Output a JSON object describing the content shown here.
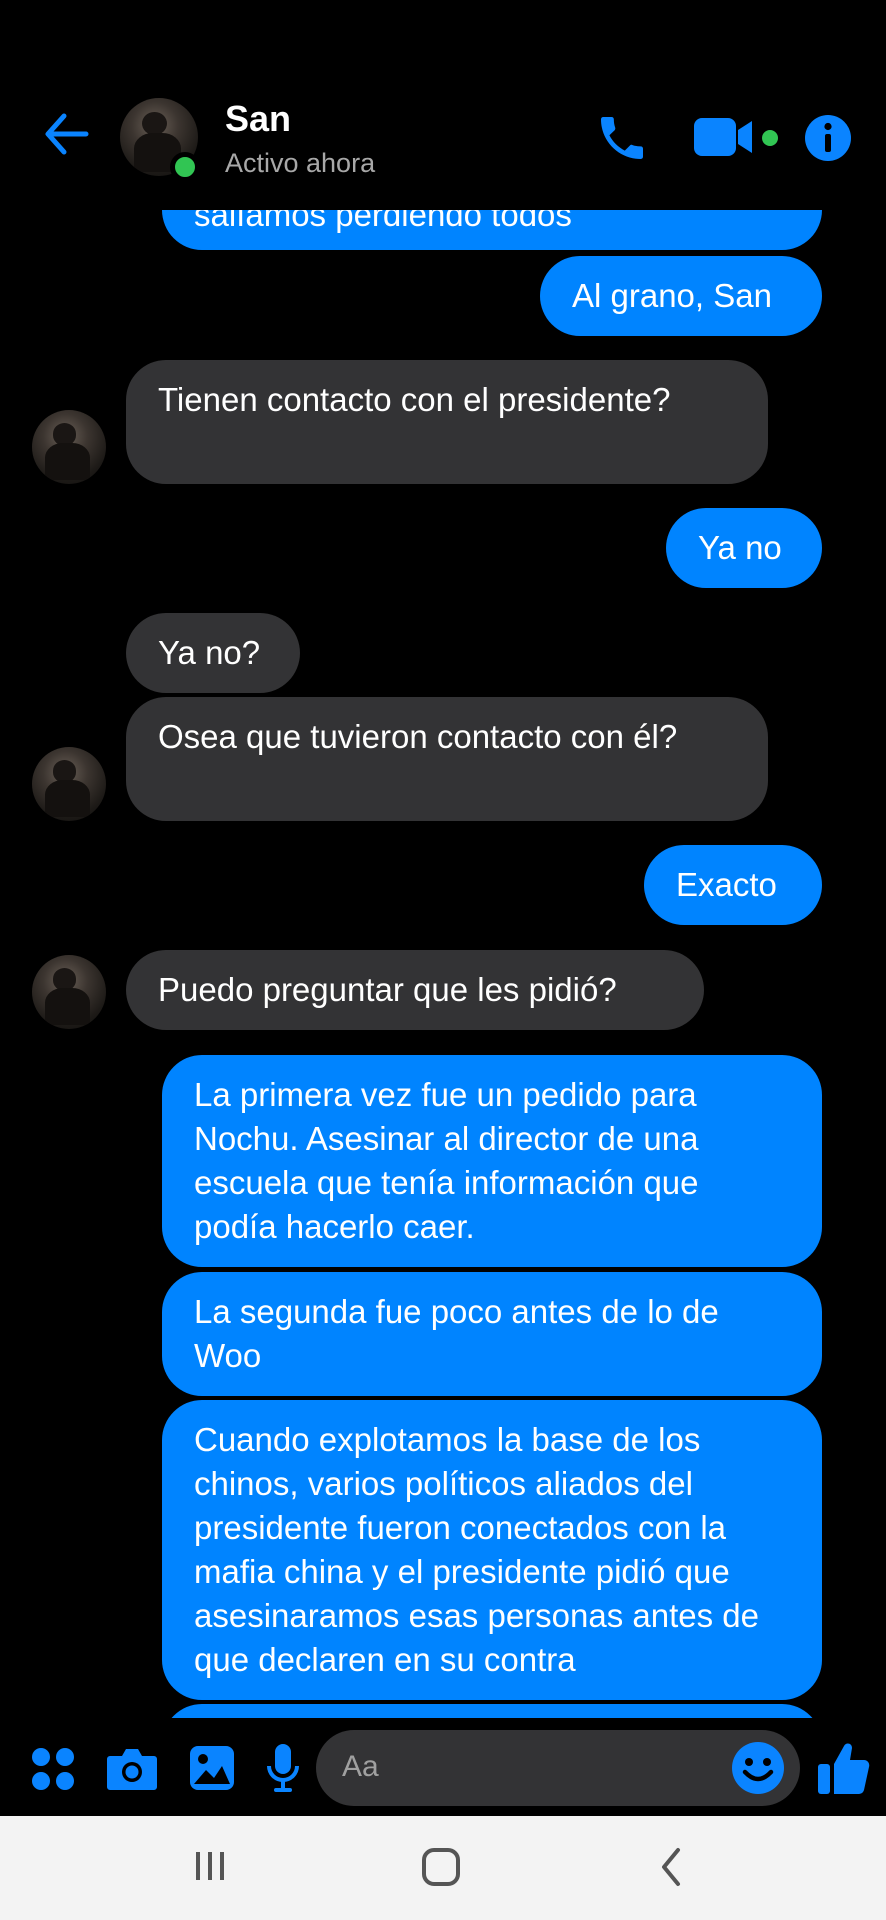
{
  "header": {
    "name": "San",
    "status": "Activo ahora"
  },
  "messages": [
    {
      "dir": "out",
      "text": "salíamos perdiendo todos"
    },
    {
      "dir": "out",
      "text": "Al grano, San"
    },
    {
      "dir": "in",
      "text": "Tienen contacto con el presidente?"
    },
    {
      "dir": "out",
      "text": "Ya no"
    },
    {
      "dir": "in",
      "text": "Ya no?"
    },
    {
      "dir": "in",
      "text": "Osea que tuvieron contacto con él?"
    },
    {
      "dir": "out",
      "text": "Exacto"
    },
    {
      "dir": "in",
      "text": "Puedo preguntar que les pidió?"
    },
    {
      "dir": "out",
      "text": "La primera vez fue un pedido para Nochu. Asesinar al director de una escuela que tenía información que podía hacerlo caer."
    },
    {
      "dir": "out",
      "text": "La segunda fue poco antes de lo de Woo"
    },
    {
      "dir": "out",
      "text": "Cuando explotamos la base de los chinos, varios políticos aliados del presidente fueron conectados con la mafia china y el presidente pidió que asesinaramos esas personas antes de que declaren en su contra"
    }
  ],
  "composer": {
    "placeholder": "Aa"
  },
  "colors": {
    "accent": "#0084ff",
    "incoming_bubble": "#333335",
    "online": "#31c553"
  },
  "icons": [
    "back-arrow-icon",
    "phone-icon",
    "video-camera-icon",
    "info-icon",
    "apps-icon",
    "camera-icon",
    "gallery-icon",
    "microphone-icon",
    "emoji-icon",
    "thumbs-up-icon",
    "recent-apps-icon",
    "home-icon",
    "back-nav-icon"
  ]
}
